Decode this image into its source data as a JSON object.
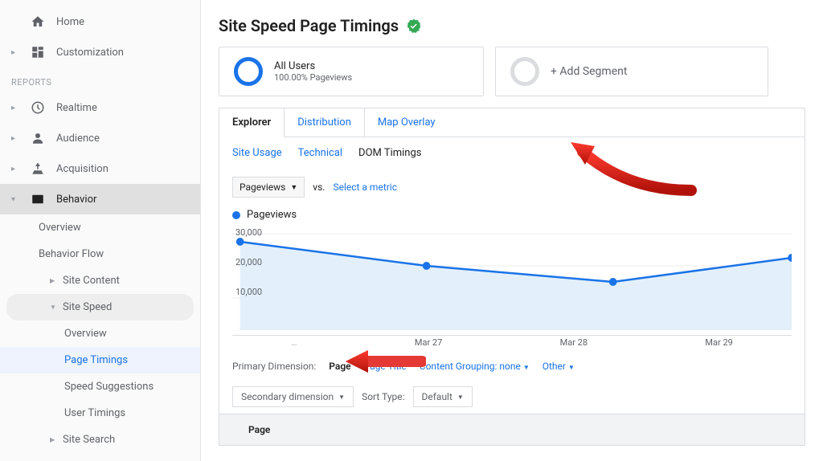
{
  "sidebar": {
    "home": "Home",
    "customization": "Customization",
    "reports_label": "REPORTS",
    "realtime": "Realtime",
    "audience": "Audience",
    "acquisition": "Acquisition",
    "behavior": "Behavior",
    "behavior_children": {
      "overview": "Overview",
      "behavior_flow": "Behavior Flow",
      "site_content": "Site Content",
      "site_speed": "Site Speed",
      "site_speed_children": {
        "overview": "Overview",
        "page_timings": "Page Timings",
        "speed_suggestions": "Speed Suggestions",
        "user_timings": "User Timings"
      },
      "site_search": "Site Search"
    }
  },
  "page": {
    "title": "Site Speed Page Timings"
  },
  "segments": {
    "all_users": {
      "title": "All Users",
      "subtitle": "100.00% Pageviews"
    },
    "add": "+ Add Segment"
  },
  "tabs": {
    "explorer": "Explorer",
    "distribution": "Distribution",
    "map_overlay": "Map Overlay"
  },
  "subtabs": {
    "site_usage": "Site Usage",
    "technical": "Technical",
    "dom_timings": "DOM Timings"
  },
  "metric": {
    "primary": "Pageviews",
    "vs": "vs.",
    "select": "Select a metric",
    "legend": "Pageviews"
  },
  "dim": {
    "label": "Primary Dimension:",
    "page": "Page",
    "page_title": "Page Title",
    "content_grouping": "Content Grouping: none",
    "other": "Other",
    "secondary": "Secondary dimension",
    "sort_label": "Sort Type:",
    "sort_value": "Default",
    "th_page": "Page"
  },
  "chart_data": {
    "type": "line",
    "series": [
      {
        "name": "Pageviews",
        "values": [
          27000,
          20000,
          15000,
          22000
        ]
      }
    ],
    "x": [
      "",
      "Mar 27",
      "Mar 28",
      "Mar 29"
    ],
    "ytick": [
      "30,000",
      "20,000",
      "10,000"
    ],
    "ylim": [
      0,
      30000
    ],
    "ylabel": "",
    "xlabel": "",
    "title": ""
  }
}
